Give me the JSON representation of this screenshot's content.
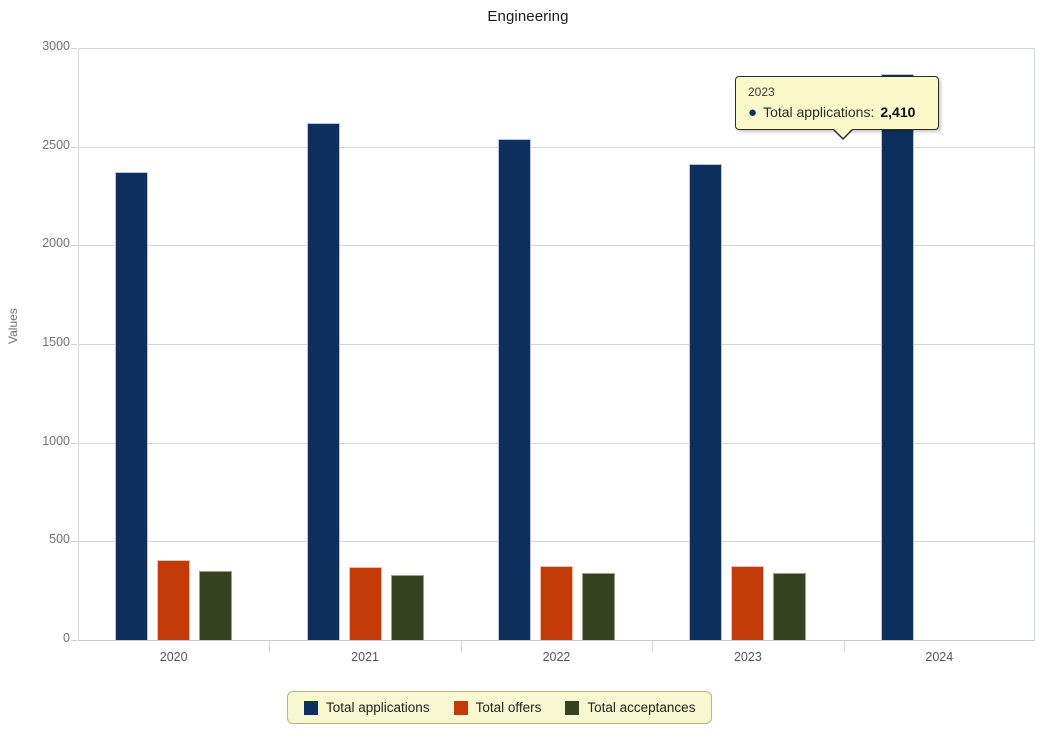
{
  "chart_data": {
    "type": "bar",
    "title": "Engineering",
    "xlabel": "",
    "ylabel": "Values",
    "categories": [
      "2020",
      "2021",
      "2022",
      "2023",
      "2024"
    ],
    "series": [
      {
        "name": "Total applications",
        "color": "#0d2f5e",
        "values": [
          2370,
          2620,
          2540,
          2410,
          2870
        ]
      },
      {
        "name": "Total offers",
        "color": "#c23a08",
        "values": [
          405,
          370,
          375,
          375,
          null
        ]
      },
      {
        "name": "Total acceptances",
        "color": "#35411f",
        "values": [
          350,
          330,
          340,
          338,
          null
        ]
      }
    ],
    "ylim": [
      0,
      3000
    ],
    "yticks": [
      0,
      500,
      1000,
      1500,
      2000,
      2500,
      3000
    ],
    "ytick_labels": [
      "0",
      "500",
      "1000",
      "1500",
      "2000",
      "2500",
      "3000"
    ],
    "grid": true,
    "legend_position": "bottom"
  },
  "legend": {
    "items": [
      {
        "label": "Total applications",
        "color": "#0d2f5e"
      },
      {
        "label": "Total offers",
        "color": "#c23a08"
      },
      {
        "label": "Total acceptances",
        "color": "#35411f"
      }
    ]
  },
  "tooltip": {
    "title": "2023",
    "bullet": "●",
    "series_label": "Total applications:",
    "value": "2,410"
  },
  "colors": {
    "applications": "#0d2f5e",
    "offers": "#c23a08",
    "acceptances": "#35411f",
    "tooltip_background": "#f9f9c9",
    "legend_background": "#f8f8d0",
    "gridline": "#d4d4d4"
  }
}
